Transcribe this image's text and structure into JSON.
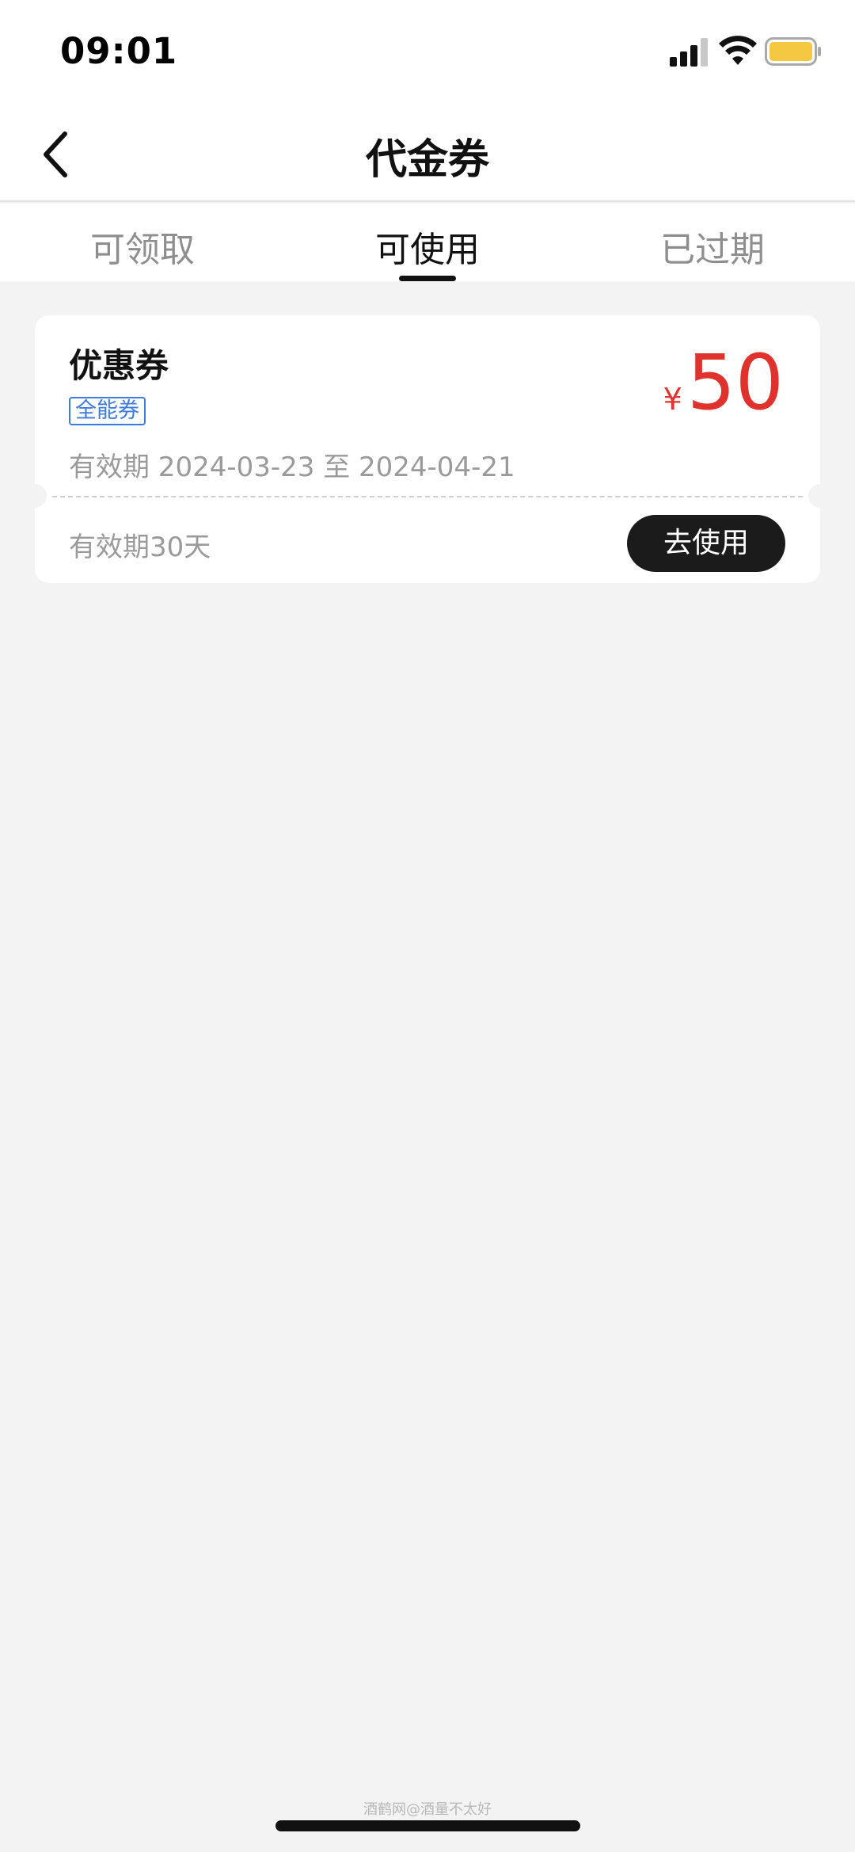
{
  "status_bar": {
    "time": "09:01",
    "icons": [
      "signal-icon",
      "wifi-icon",
      "battery-icon"
    ],
    "battery_color": "#f5c842"
  },
  "nav": {
    "title": "代金券",
    "back_icon": "chevron-left-icon"
  },
  "tabs": [
    {
      "label": "可领取",
      "active": false
    },
    {
      "label": "可使用",
      "active": true
    },
    {
      "label": "已过期",
      "active": false
    }
  ],
  "coupon": {
    "title": "优惠券",
    "tag": "全能券",
    "validity_range": "有效期 2024-03-23 至 2024-04-21",
    "currency": "¥",
    "amount": "50",
    "validity_days": "有效期30天",
    "action_label": "去使用",
    "amount_color": "#e0312d",
    "tag_color": "#3d7be0"
  },
  "watermark": "酒鹤网@酒量不太好",
  "colors": {
    "background": "#f3f3f3",
    "accent_dark": "#1b1b1b"
  }
}
